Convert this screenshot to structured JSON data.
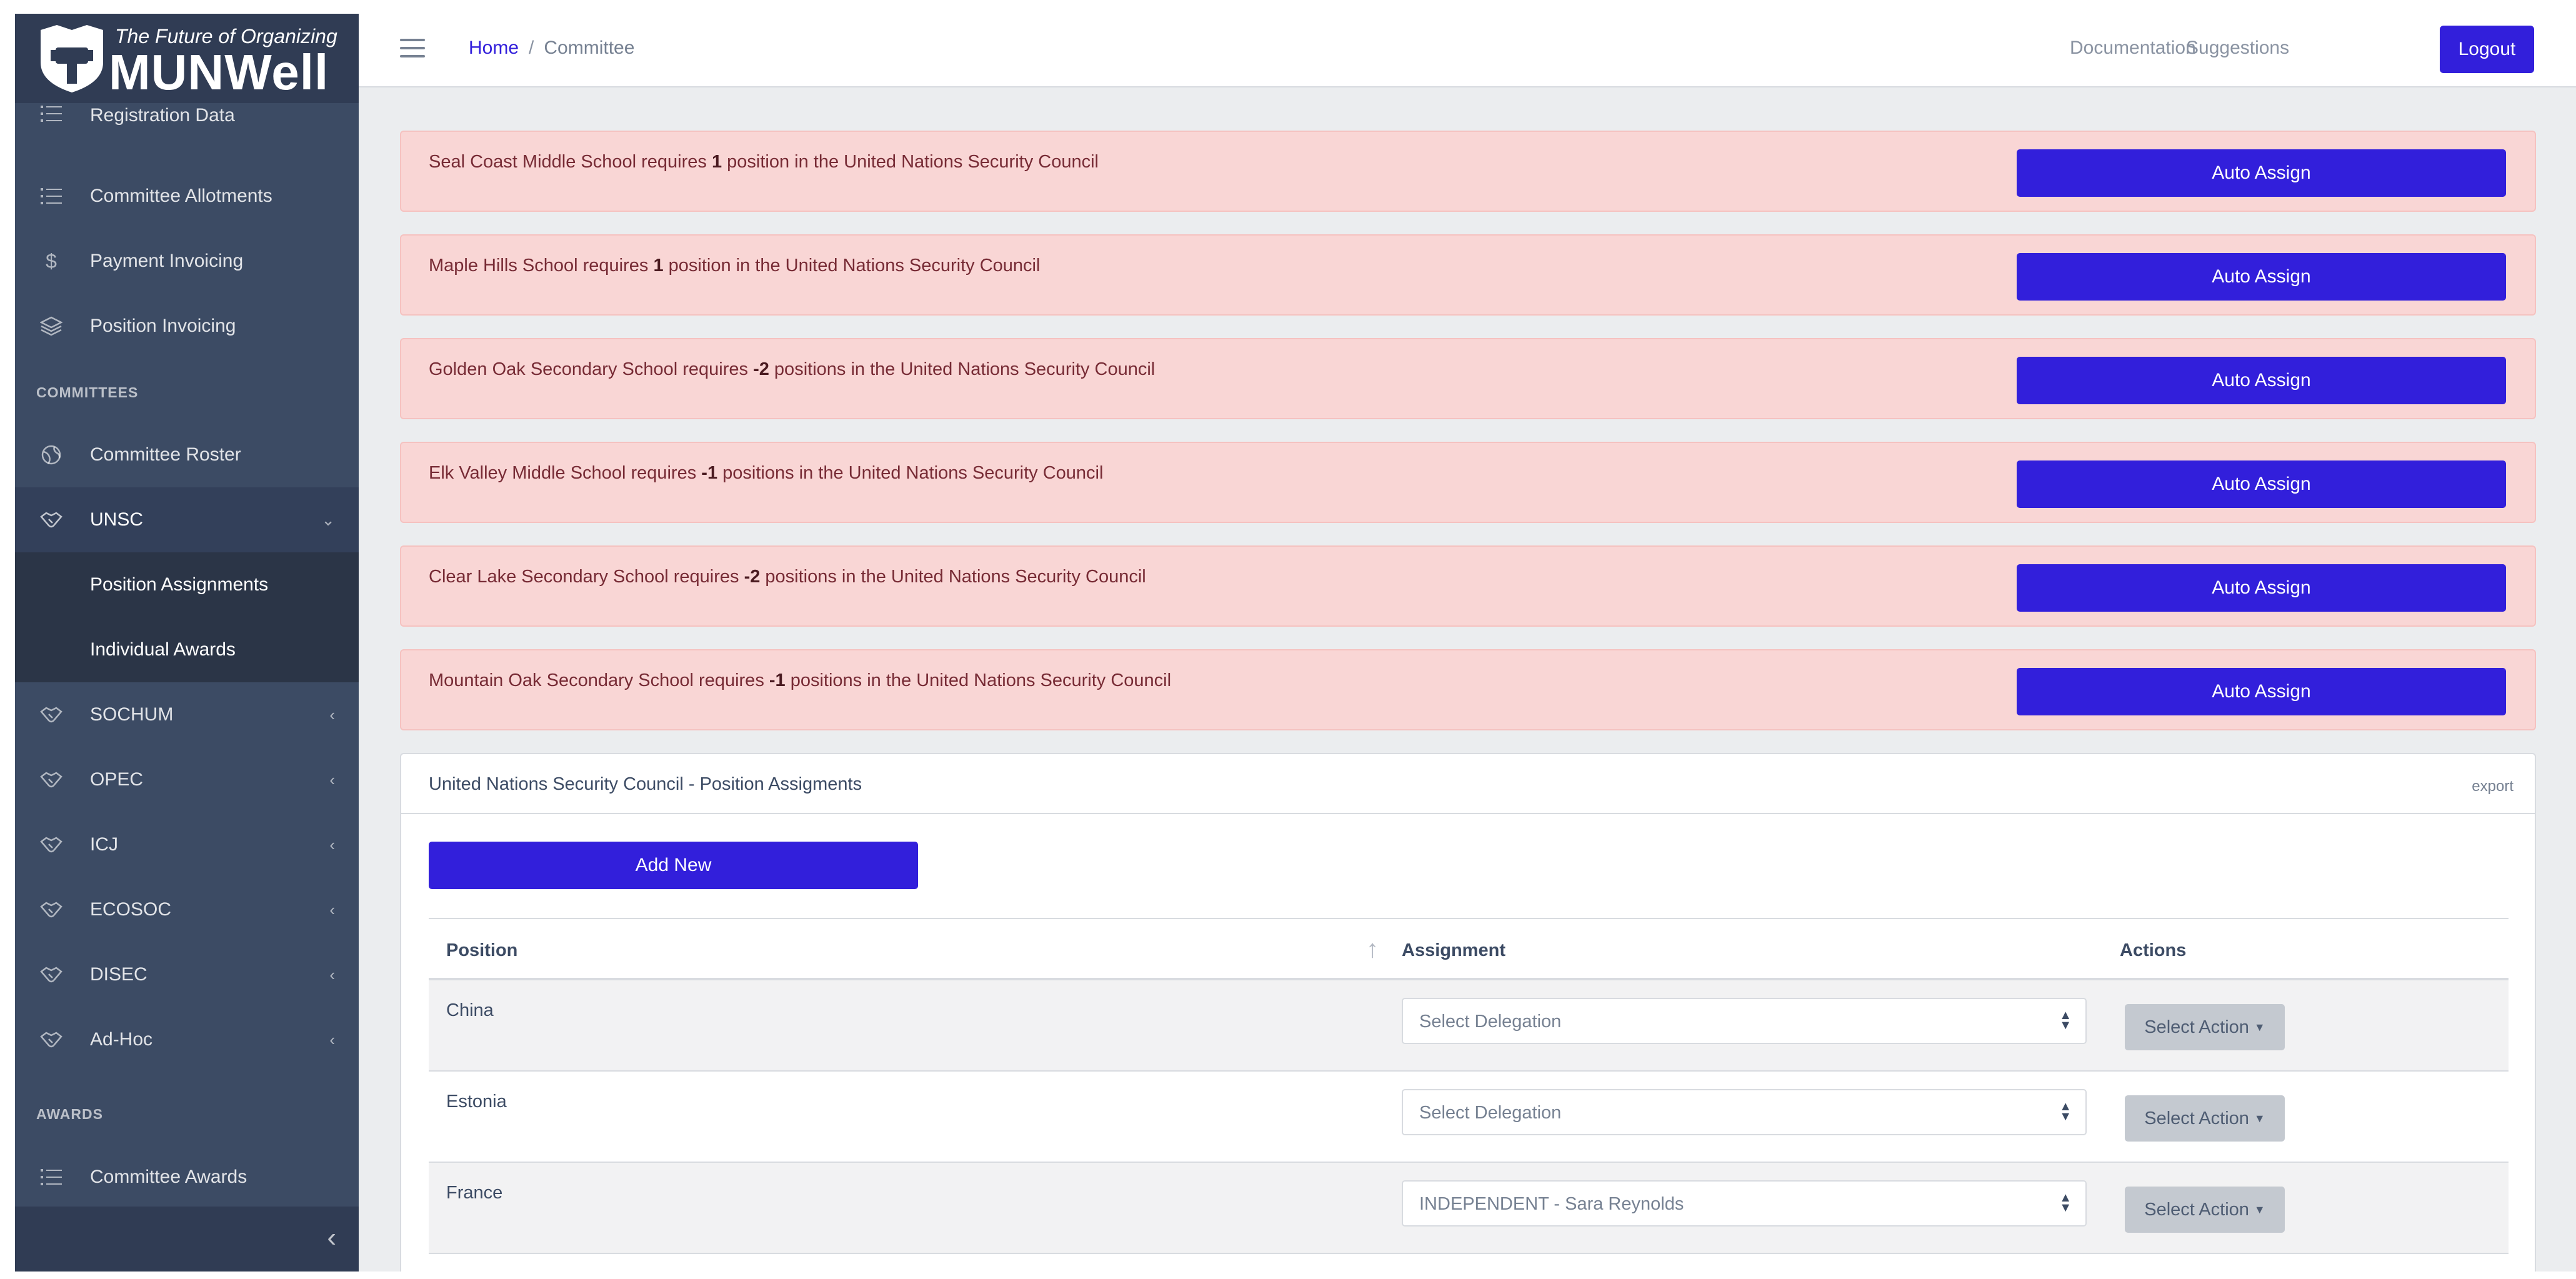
{
  "brand": {
    "tagline": "The Future of Organizing",
    "name": "MUNWell"
  },
  "sidebar": {
    "items_top": [
      {
        "label": "Registration Data",
        "icon": "list-icon"
      },
      {
        "label": "Committee Allotments",
        "icon": "list-icon"
      },
      {
        "label": "Payment Invoicing",
        "icon": "dollar-icon"
      },
      {
        "label": "Position Invoicing",
        "icon": "layers-icon"
      }
    ],
    "section_committees": "COMMITTEES",
    "committee_roster": "Committee Roster",
    "unsc": "UNSC",
    "unsc_children": [
      "Position Assignments",
      "Individual Awards"
    ],
    "committees": [
      "SOCHUM",
      "OPEC",
      "ICJ",
      "ECOSOC",
      "DISEC",
      "Ad-Hoc"
    ],
    "section_awards": "AWARDS",
    "committee_awards": "Committee Awards"
  },
  "header": {
    "breadcrumb_home": "Home",
    "breadcrumb_sep": "/",
    "breadcrumb_current": "Committee",
    "documentation": "Documentation",
    "suggestions": "Suggestions",
    "logout": "Logout"
  },
  "alerts": [
    {
      "school": "Seal Coast Middle School",
      "mid": " requires ",
      "count": "1",
      "suffix": " position in the United Nations Security Council",
      "button": "Auto Assign"
    },
    {
      "school": "Maple Hills School",
      "mid": " requires ",
      "count": "1",
      "suffix": " position in the United Nations Security Council",
      "button": "Auto Assign"
    },
    {
      "school": "Golden Oak Secondary School",
      "mid": " requires ",
      "count": "-2",
      "suffix": " positions in the United Nations Security Council",
      "button": "Auto Assign"
    },
    {
      "school": "Elk Valley Middle School",
      "mid": " requires ",
      "count": "-1",
      "suffix": " positions in the United Nations Security Council",
      "button": "Auto Assign"
    },
    {
      "school": "Clear Lake Secondary School",
      "mid": " requires ",
      "count": "-2",
      "suffix": " positions in the United Nations Security Council",
      "button": "Auto Assign"
    },
    {
      "school": "Mountain Oak Secondary School",
      "mid": " requires ",
      "count": "-1",
      "suffix": " positions in the United Nations Security Council",
      "button": "Auto Assign"
    }
  ],
  "card": {
    "title": "United Nations Security Council - Position Assigments",
    "export": "export",
    "add_new": "Add New",
    "columns": {
      "position": "Position",
      "assignment": "Assignment",
      "actions": "Actions"
    },
    "rows": [
      {
        "position": "China",
        "assignment": "Select Delegation",
        "action": "Select Action"
      },
      {
        "position": "Estonia",
        "assignment": "Select Delegation",
        "action": "Select Action"
      },
      {
        "position": "France",
        "assignment": "INDEPENDENT - Sara Reynolds",
        "action": "Select Action"
      }
    ]
  },
  "colors": {
    "primary": "#321fdb",
    "sidebar": "#3c4b64",
    "alert_bg": "#f9d6d5"
  }
}
